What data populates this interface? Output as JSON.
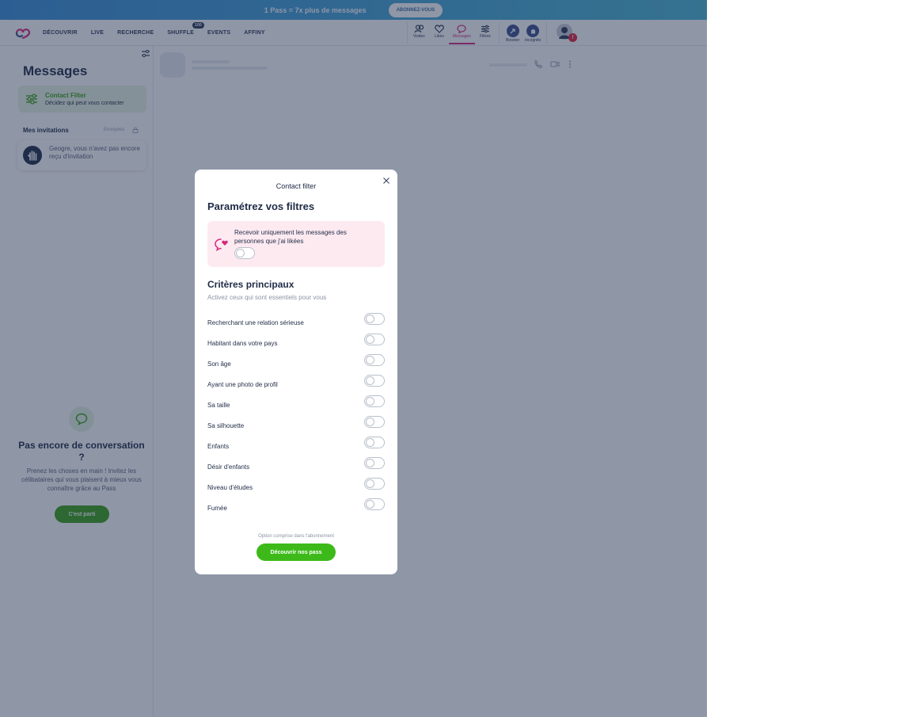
{
  "promo": {
    "text": "1 Pass = 7x plus de messages",
    "cta": "ABONNEZ-VOUS"
  },
  "nav": {
    "items": [
      "DÉCOUVRIR",
      "LIVE",
      "RECHERCHE",
      "SHUFFLE",
      "EVENTS",
      "AFFINY"
    ],
    "shuffle_badge": "100"
  },
  "header_tools": {
    "visites": "Visites",
    "likes": "Likes",
    "messages": "Messages",
    "filtres": "Filtres",
    "booster": "Booster",
    "incognito": "Incognito",
    "alert": "!"
  },
  "sidebar": {
    "title": "Messages",
    "contact_filter": {
      "title": "Contact Filter",
      "subtitle": "Décidez qui peut vous contacter"
    },
    "invitations": {
      "title": "Mes invitations",
      "sent": "Envoyées",
      "empty": "Geogre, vous n'avez pas encore reçu d'invitation"
    },
    "empty_state": {
      "title": "Pas encore de conversation ?",
      "text": "Prenez les choses en main ! Invitez les célibataires qui vous plaisent à mieux vous connaître grâce au Pass",
      "cta": "C'est parti"
    }
  },
  "modal": {
    "header": "Contact filter",
    "title": "Paramétrez vos filtres",
    "liked_only": {
      "label": "Recevoir uniquement les messages des personnes que j'ai likées",
      "enabled": false
    },
    "section_title": "Critères principaux",
    "section_subtitle": "Activez ceux qui sont essentiels pour vous",
    "criteria": [
      {
        "label": "Recherchant une relation sérieuse",
        "enabled": false
      },
      {
        "label": "Habitant dans votre pays",
        "enabled": false
      },
      {
        "label": "Son âge",
        "enabled": false
      },
      {
        "label": "Ayant une photo de profil",
        "enabled": false
      },
      {
        "label": "Sa taille",
        "enabled": false
      },
      {
        "label": "Sa silhouette",
        "enabled": false
      },
      {
        "label": "Enfants",
        "enabled": false
      },
      {
        "label": "Désir d'enfants",
        "enabled": false
      },
      {
        "label": "Niveau d'études",
        "enabled": false
      },
      {
        "label": "Fumée",
        "enabled": false
      }
    ],
    "footnote": "Option comprise dans l'abonnement",
    "cta": "Découvrir nos pass"
  },
  "colors": {
    "brand": "#d6287e",
    "green": "#3dba1a",
    "navy": "#1f2b46",
    "overlay": "rgba(32,46,78,0.5)"
  }
}
